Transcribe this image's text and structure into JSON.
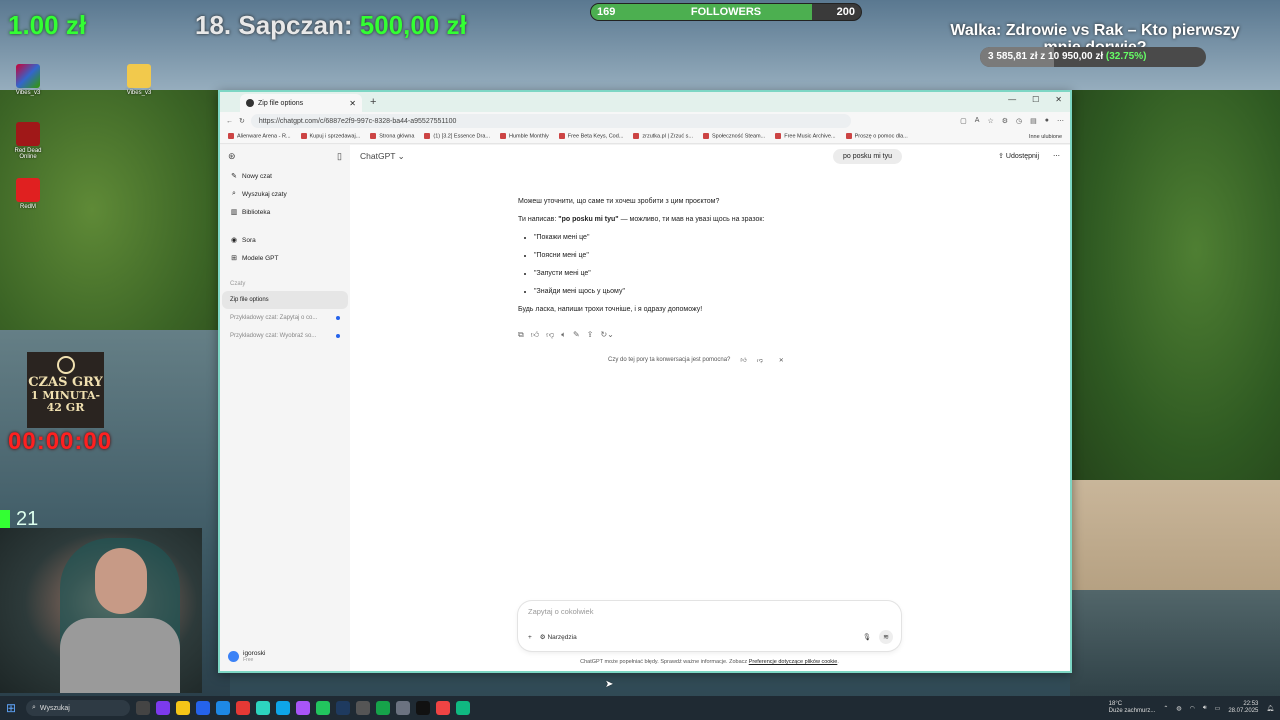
{
  "overlay": {
    "donation_amount": "1.00 zł",
    "sapczan_label": "18. Sapczan:",
    "sapczan_amount": "500,00 zł",
    "followers": {
      "min": "169",
      "title": "FOLLOWERS",
      "max": "200",
      "progress": 0.82
    },
    "walka_title": "Walka: Zdrowie vs Rak – Kto pierwszy mnie dorwie?",
    "walka_amount": "3 585,81 zł",
    "walka_of": "z",
    "walka_goal": "10 950,00 zł",
    "walka_pct": "(32.75%)",
    "walka_progress": 0.3275,
    "czas_line1": "CZAS GRY",
    "czas_line2": "1 MINUTA-",
    "czas_line3": "42 GR",
    "timer": "00:00:00",
    "counter": "21"
  },
  "desktop_icons": [
    {
      "label": "Vibes_v3"
    },
    {
      "label": "Vibes_v3"
    },
    {
      "label": "Red Dead Online"
    },
    {
      "label": "RedM"
    }
  ],
  "browser": {
    "tab_title": "Zip file options",
    "url": "https://chatgpt.com/c/6887e2f9-997c-8328-ba44-a95527551100",
    "bookmarks": [
      "Alienware Arena - R...",
      "Kupuj i sprzedawaj...",
      "Strona główna",
      "(1) [3.2] Essence Dra...",
      "Humble Monthly",
      "Free Beta Keys, Cod...",
      "zrzutka.pl | Zrzuć s...",
      "Społeczność Steam...",
      "Free Music Archive...",
      "Proszę o pomoc dla..."
    ],
    "other_bookmarks": "Inne ulubione"
  },
  "sidebar": {
    "items": [
      {
        "label": "Nowy czat",
        "icon": "edit-icon"
      },
      {
        "label": "Wyszukaj czaty",
        "icon": "search-icon"
      },
      {
        "label": "Biblioteka",
        "icon": "library-icon"
      },
      {
        "label": "Sora",
        "icon": "sora-icon"
      },
      {
        "label": "Modele GPT",
        "icon": "grid-icon"
      }
    ],
    "section_label": "Czaty",
    "chats": [
      {
        "label": "Zip file options",
        "active": true
      },
      {
        "label": "Przykładowy czat: Zapytaj o co...",
        "active": false
      },
      {
        "label": "Przykładowy czat: Wyobraź so...",
        "active": false
      }
    ],
    "user_name": "igoroski",
    "user_plan": "Free"
  },
  "main": {
    "model_label": "ChatGPT",
    "share_label": "Udostępnij",
    "user_message": "po posku mi tyu",
    "answer_intro": "Можеш уточнити, що саме ти хочеш зробити з цим проєктом?",
    "answer_line_pre": "Ти написав:",
    "answer_line_bold": "\"po posku mi tyu\"",
    "answer_line_post": "— можливо, ти мав на увазі щось на зразок:",
    "answer_bullets": [
      "\"Покажи мені це\"",
      "\"Поясни мені це\"",
      "\"Запусти мені це\"",
      "\"Знайди мені щось у цьому\""
    ],
    "answer_outro": "Будь ласка, напиши трохи точніше, і я одразу допоможу!",
    "feedback_question": "Czy do tej pory ta konwersacja jest pomocna?",
    "composer_placeholder": "Zapytaj o cokolwiek",
    "tools_label": "Narzędzia",
    "disclaimer_text": "ChatGPT może popełniać błędy. Sprawdź ważne informacje. Zobacz",
    "disclaimer_link": "Preferencje dotyczące plików cookie",
    "disclaimer_end": "."
  },
  "taskbar": {
    "search_placeholder": "Wyszukaj",
    "weather_temp": "18°C",
    "weather_desc": "Duże zachmurz...",
    "time": "22:53",
    "date": "28.07.2025"
  }
}
